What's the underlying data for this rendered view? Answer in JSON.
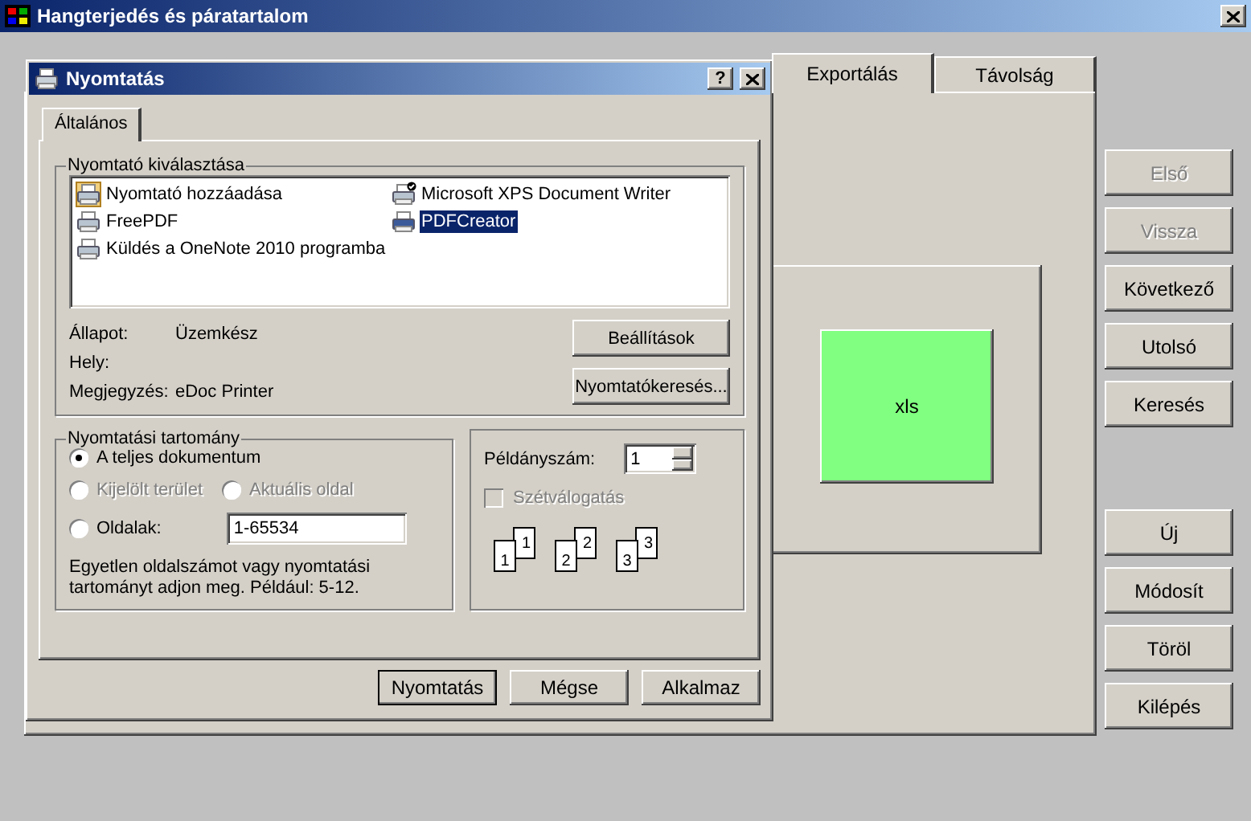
{
  "window": {
    "title": "Hangterjedés és páratartalom"
  },
  "tabs": [
    {
      "label": "Exportálás",
      "selected": true
    },
    {
      "label": "Távolság",
      "selected": false
    }
  ],
  "preview": {
    "label": "xls",
    "color": "#80ff80"
  },
  "side_buttons": [
    {
      "label": "Első",
      "disabled": true
    },
    {
      "label": "Vissza",
      "disabled": true
    },
    {
      "label": "Következő",
      "disabled": false
    },
    {
      "label": "Utolsó",
      "disabled": false
    },
    {
      "label": "Keresés",
      "disabled": false
    },
    {
      "label": "Új",
      "disabled": false
    },
    {
      "label": "Módosít",
      "disabled": false
    },
    {
      "label": "Töröl",
      "disabled": false
    },
    {
      "label": "Kilépés",
      "disabled": false
    }
  ],
  "dialog": {
    "title": "Nyomtatás",
    "help": "?",
    "tabs": [
      {
        "label": "Általános",
        "selected": true
      }
    ],
    "printer_group": {
      "title": "Nyomtató kiválasztása",
      "printers": [
        {
          "name": "Nyomtató hozzáadása",
          "kind": "add",
          "selected": false
        },
        {
          "name": "Microsoft XPS Document Writer",
          "kind": "default",
          "selected": false
        },
        {
          "name": "FreePDF",
          "kind": "printer",
          "selected": false
        },
        {
          "name": "PDFCreator",
          "kind": "printer",
          "selected": true
        },
        {
          "name": "Küldés a OneNote 2010 programba",
          "kind": "printer",
          "selected": false
        }
      ],
      "info": [
        {
          "label": "Állapot:",
          "value": "Üzemkész"
        },
        {
          "label": "Hely:"
        },
        {
          "label": "Megjegyzés:",
          "value": "eDoc Printer"
        }
      ],
      "buttons": [
        "Beállítások",
        "Nyomtatókeresés..."
      ]
    },
    "range_group": {
      "title": "Nyomtatási tartomány",
      "options": [
        {
          "label": "A teljes dokumentum",
          "selected": true,
          "disabled": false
        },
        {
          "label": "Kijelölt terület",
          "selected": false,
          "disabled": true
        },
        {
          "label": "Aktuális oldal",
          "selected": false,
          "disabled": true
        },
        {
          "label": "Oldalak:",
          "selected": false,
          "disabled": false
        }
      ],
      "pages_value": "1-65534",
      "hint": "Egyetlen oldalszámot vagy nyomtatási tartományt adjon meg. Például: 5-12."
    },
    "copies": {
      "label": "Példányszám:",
      "value": "1",
      "collate": {
        "label": "Szétválogatás",
        "checked": false,
        "disabled": true
      },
      "pages": [
        {
          "front": "1",
          "back": "1"
        },
        {
          "front": "2",
          "back": "2"
        },
        {
          "front": "3",
          "back": "3"
        }
      ]
    },
    "buttons": [
      {
        "label": "Nyomtatás",
        "default": true
      },
      {
        "label": "Mégse",
        "default": false
      },
      {
        "label": "Alkalmaz",
        "default": false
      }
    ]
  }
}
